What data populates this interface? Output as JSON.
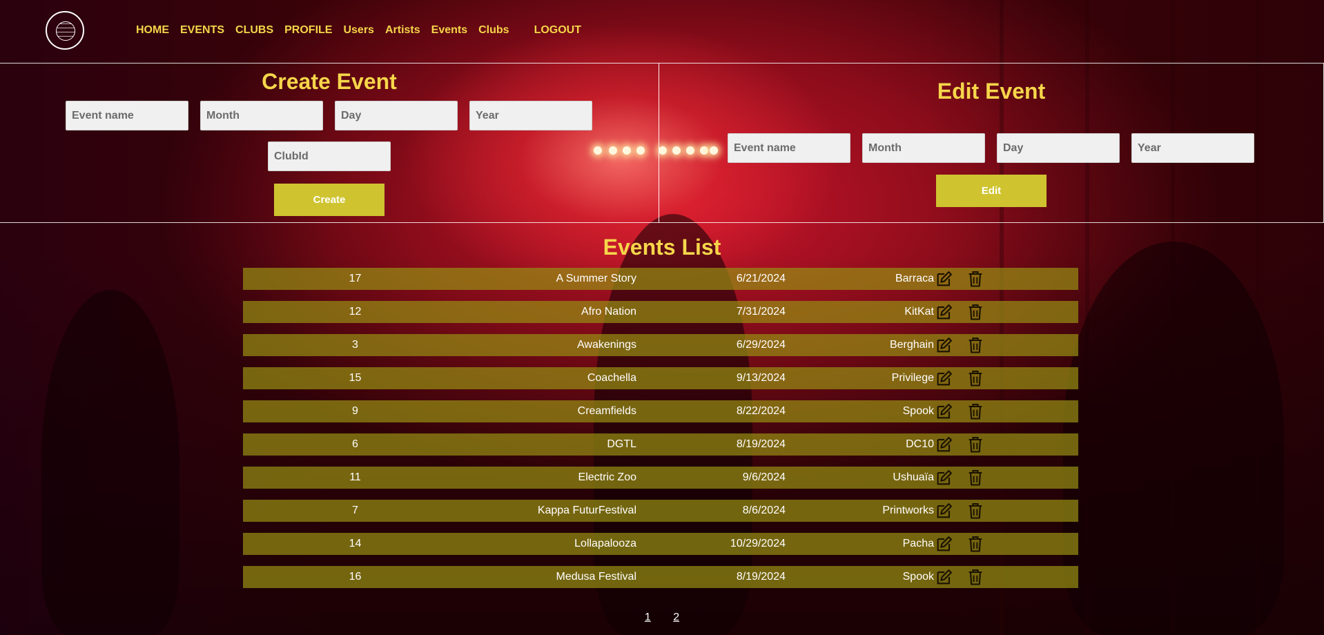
{
  "logo": {
    "alt_text": "ELECTRONIC ADVISOR",
    "icon": "globe-logo"
  },
  "nav": {
    "items": [
      {
        "label": "HOME"
      },
      {
        "label": "EVENTS"
      },
      {
        "label": "CLUBS"
      },
      {
        "label": "PROFILE"
      },
      {
        "label": "Users"
      },
      {
        "label": "Artists"
      },
      {
        "label": "Events"
      },
      {
        "label": "Clubs"
      }
    ],
    "logout": "LOGOUT"
  },
  "create_event": {
    "title": "Create Event",
    "placeholders": {
      "event_name": "Event name",
      "month": "Month",
      "day": "Day",
      "year": "Year",
      "club_id": "ClubId"
    },
    "button": "Create"
  },
  "edit_event": {
    "title": "Edit Event",
    "placeholders": {
      "event_name": "Event name",
      "month": "Month",
      "day": "Day",
      "year": "Year"
    },
    "button": "Edit"
  },
  "events_list": {
    "title": "Events List",
    "rows": [
      {
        "id": "17",
        "name": "A Summer Story",
        "date": "6/21/2024",
        "club": "Barraca"
      },
      {
        "id": "12",
        "name": "Afro Nation",
        "date": "7/31/2024",
        "club": "KitKat"
      },
      {
        "id": "3",
        "name": "Awakenings",
        "date": "6/29/2024",
        "club": "Berghain"
      },
      {
        "id": "15",
        "name": "Coachella",
        "date": "9/13/2024",
        "club": "Privilege"
      },
      {
        "id": "9",
        "name": "Creamfields",
        "date": "8/22/2024",
        "club": "Spook"
      },
      {
        "id": "6",
        "name": "DGTL",
        "date": "8/19/2024",
        "club": "DC10"
      },
      {
        "id": "11",
        "name": "Electric Zoo",
        "date": "9/6/2024",
        "club": "Ushuaïa"
      },
      {
        "id": "7",
        "name": "Kappa FuturFestival",
        "date": "8/6/2024",
        "club": "Printworks"
      },
      {
        "id": "14",
        "name": "Lollapalooza",
        "date": "10/29/2024",
        "club": "Pacha"
      },
      {
        "id": "16",
        "name": "Medusa Festival",
        "date": "8/19/2024",
        "club": "Spook"
      }
    ],
    "row_icons": {
      "edit": "edit-icon",
      "delete": "trash-icon"
    }
  },
  "pagination": {
    "pages": [
      "1",
      "2"
    ]
  },
  "colors": {
    "accent": "#f6d64a",
    "button": "#cfc430",
    "row_bg": "#968c14"
  }
}
